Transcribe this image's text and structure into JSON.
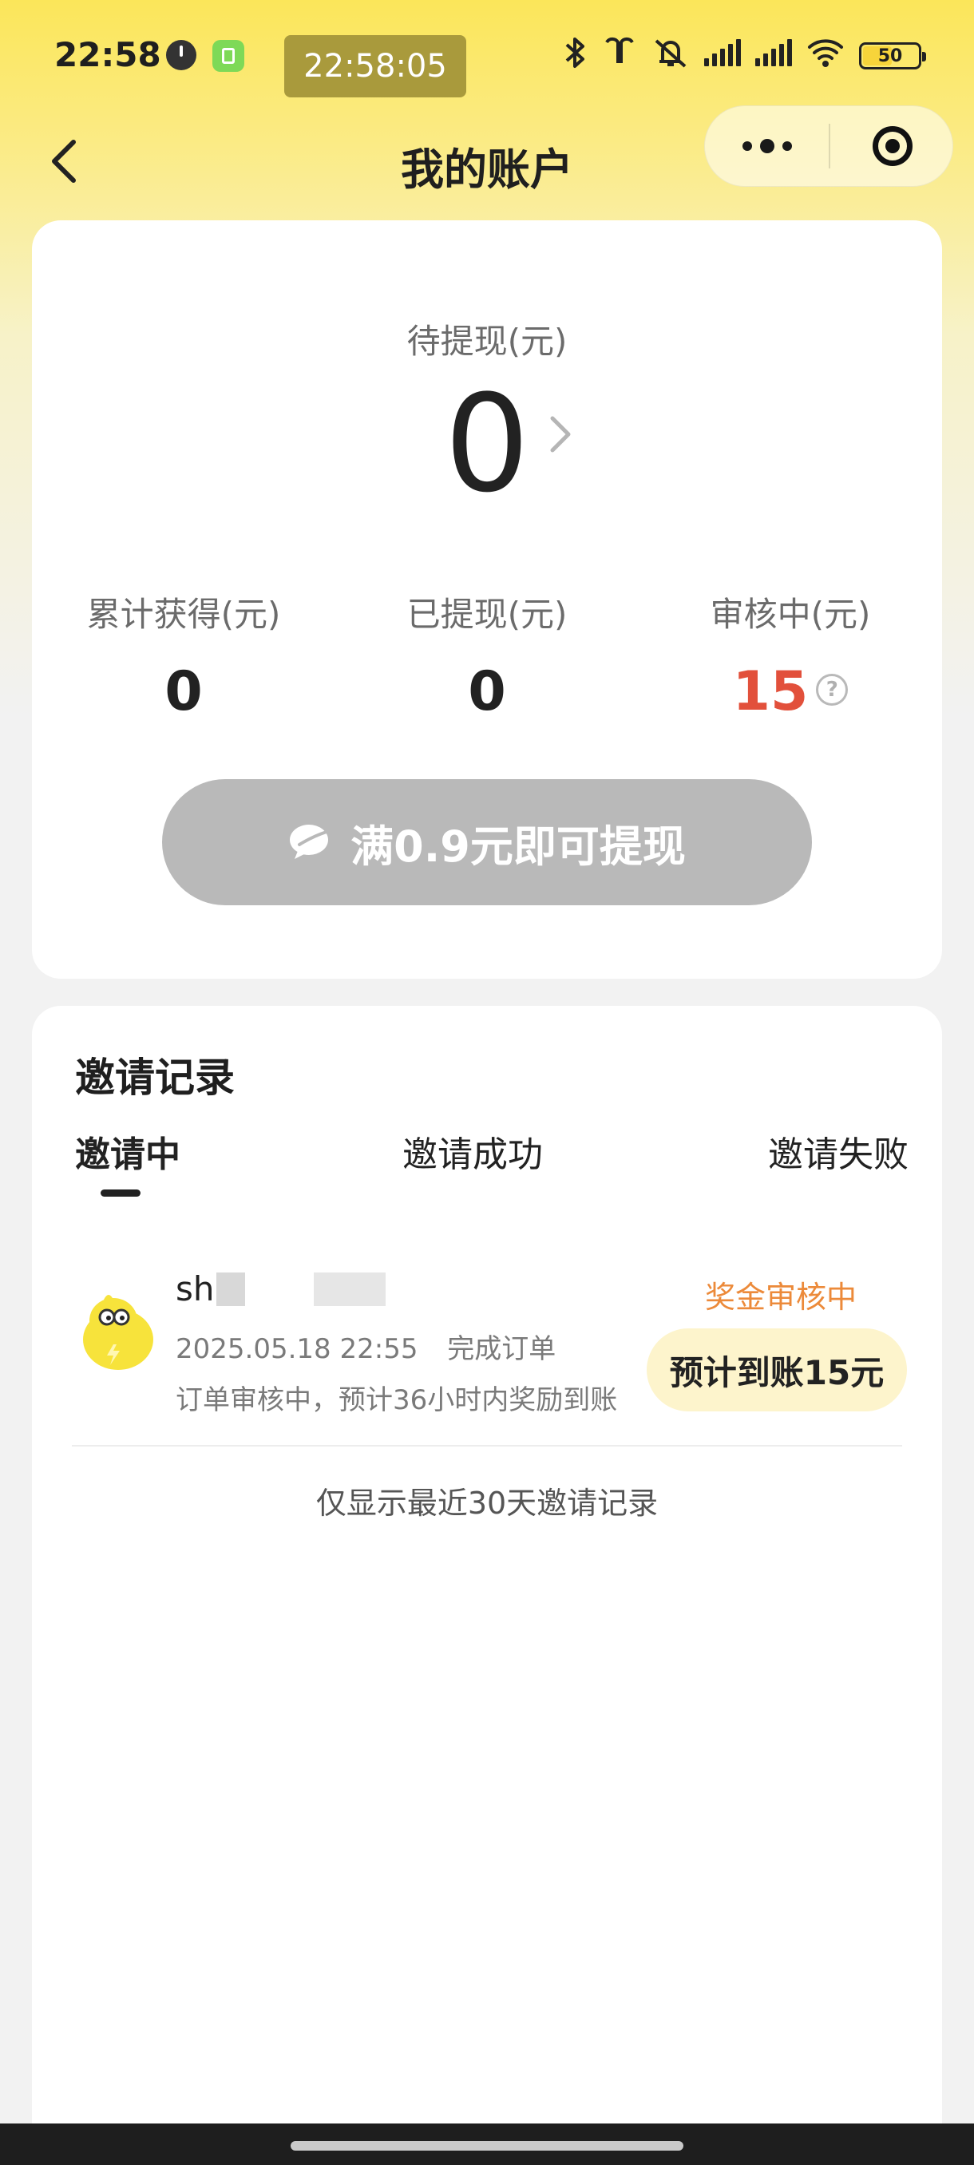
{
  "status_bar": {
    "time": "22:58",
    "recording_chip": "22:58:05",
    "battery": "50",
    "icons": [
      "clock-icon",
      "app-icon",
      "bluetooth-icon",
      "earbuds-icon",
      "mute-icon",
      "hd-signal-icon",
      "signal-icon",
      "wifi-icon",
      "battery-icon"
    ]
  },
  "nav": {
    "title": "我的账户"
  },
  "account": {
    "pending_label": "待提现(元)",
    "pending_amount": "0",
    "stats": [
      {
        "label": "累计获得(元)",
        "value": "0"
      },
      {
        "label": "已提现(元)",
        "value": "0"
      },
      {
        "label": "审核中(元)",
        "value": "15"
      }
    ],
    "help_glyph": "?",
    "withdraw_label": "满0.9元即可提现"
  },
  "invites": {
    "title": "邀请记录",
    "tabs": [
      "邀请中",
      "邀请成功",
      "邀请失败"
    ],
    "record": {
      "name": "sh",
      "time": "2025.05.18 22:55",
      "action": "完成订单",
      "note": "订单审核中，预计36小时内奖励到账",
      "status": "奖金审核中",
      "expected": "预计到账15元"
    },
    "footer": "仅显示最近30天邀请记录"
  },
  "colors": {
    "accent_yellow": "#fbe65a",
    "amount_red": "#e2503b",
    "status_orange": "#ec8a3a",
    "disabled_button": "#b9b9b9"
  }
}
